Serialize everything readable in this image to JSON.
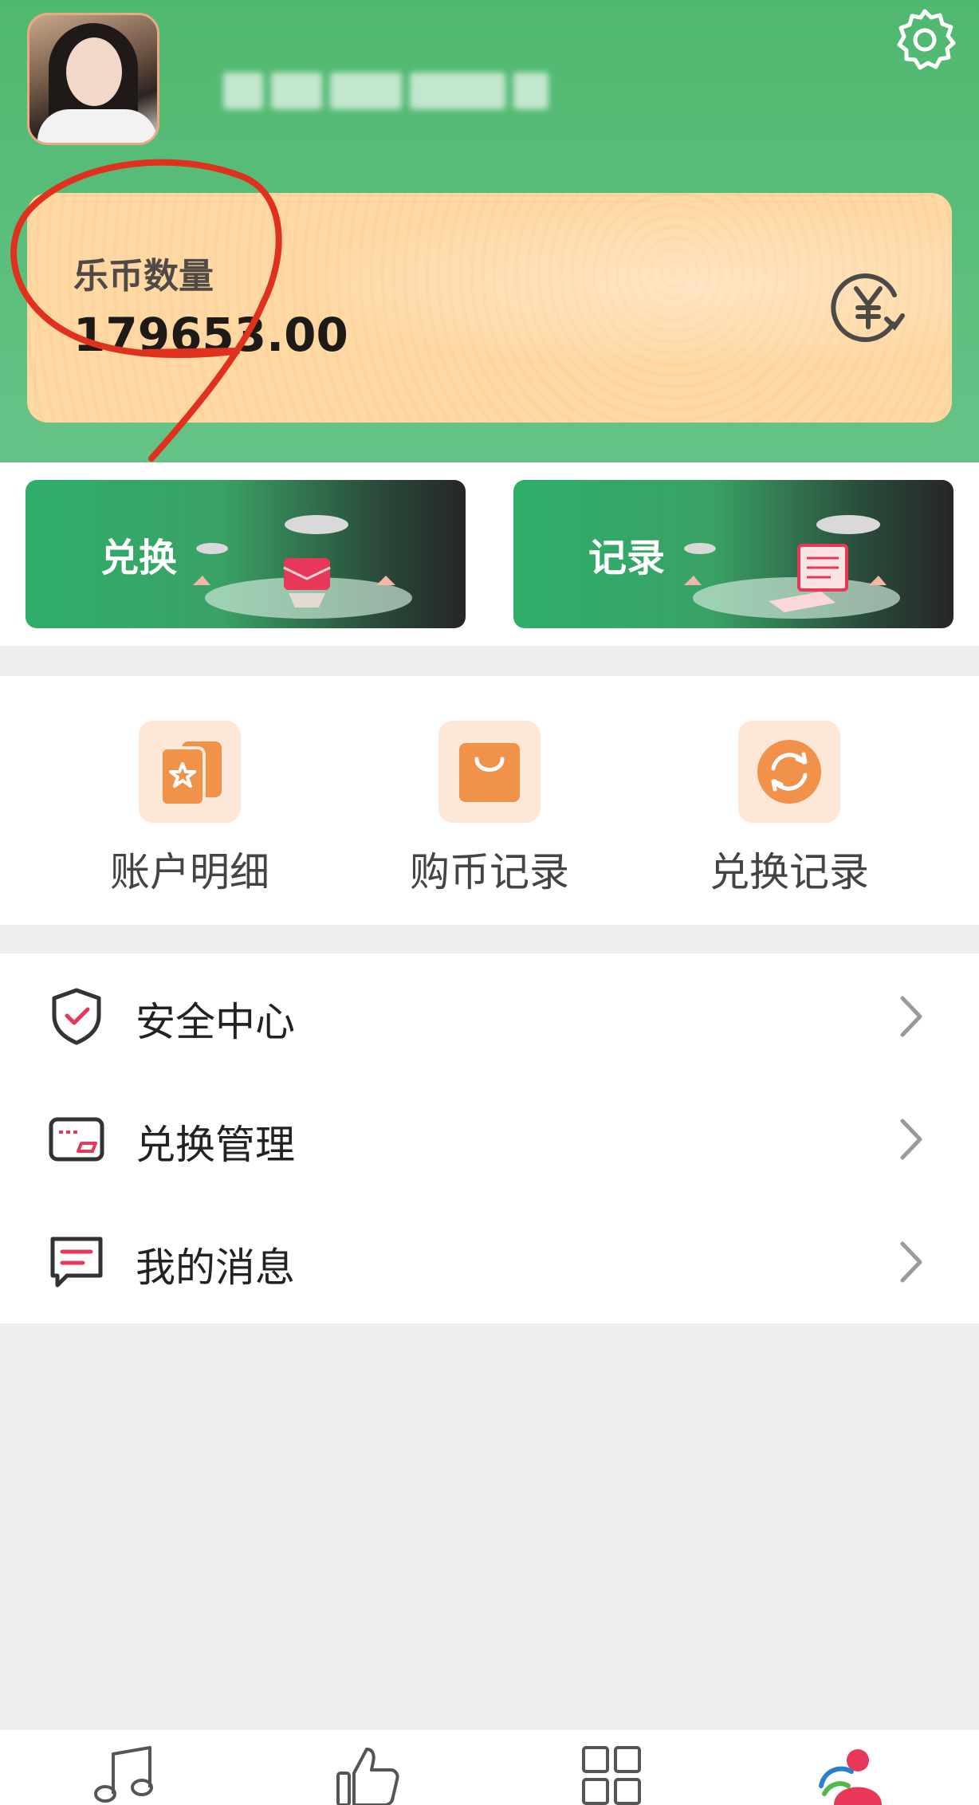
{
  "header": {
    "avatar_alt": "avatar",
    "settings_icon": "gear-icon"
  },
  "coins": {
    "label": "乐币数量",
    "value": "179653.00",
    "exchange_icon": "yuan-exchange-icon"
  },
  "actions": [
    {
      "label": "兑换",
      "icon": "wallet-illustration"
    },
    {
      "label": "记录",
      "icon": "notebook-illustration"
    }
  ],
  "quick_links": [
    {
      "label": "账户明细",
      "icon": "cards-star-icon"
    },
    {
      "label": "购币记录",
      "icon": "shopping-bag-icon"
    },
    {
      "label": "兑换记录",
      "icon": "refresh-circle-icon"
    }
  ],
  "menu": [
    {
      "label": "安全中心",
      "icon": "shield-check-icon"
    },
    {
      "label": "兑换管理",
      "icon": "card-icon"
    },
    {
      "label": "我的消息",
      "icon": "message-icon"
    }
  ],
  "tabbar": [
    {
      "icon": "music-note-icon"
    },
    {
      "icon": "thumbs-up-icon"
    },
    {
      "icon": "grid-icon"
    },
    {
      "icon": "profile-icon"
    }
  ],
  "colors": {
    "header_green": "#4fb86f",
    "card_peach": "#ffd8a3",
    "accent_orange": "#f0924a",
    "accent_pink": "#e8385a",
    "annotation_red": "#e0301e"
  }
}
